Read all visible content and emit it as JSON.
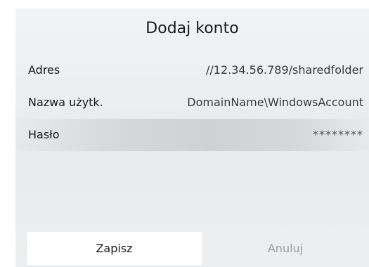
{
  "dialog": {
    "title": "Dodaj konto",
    "fields": [
      {
        "label": "Adres",
        "value": "//12.34.56.789/sharedfolder"
      },
      {
        "label": "Nazwa użytk.",
        "value": "DomainName\\WindowsAccount"
      },
      {
        "label": "Hasło",
        "value": "********"
      }
    ],
    "buttons": {
      "save_label": "Zapisz",
      "cancel_label": "Anuluj"
    }
  }
}
